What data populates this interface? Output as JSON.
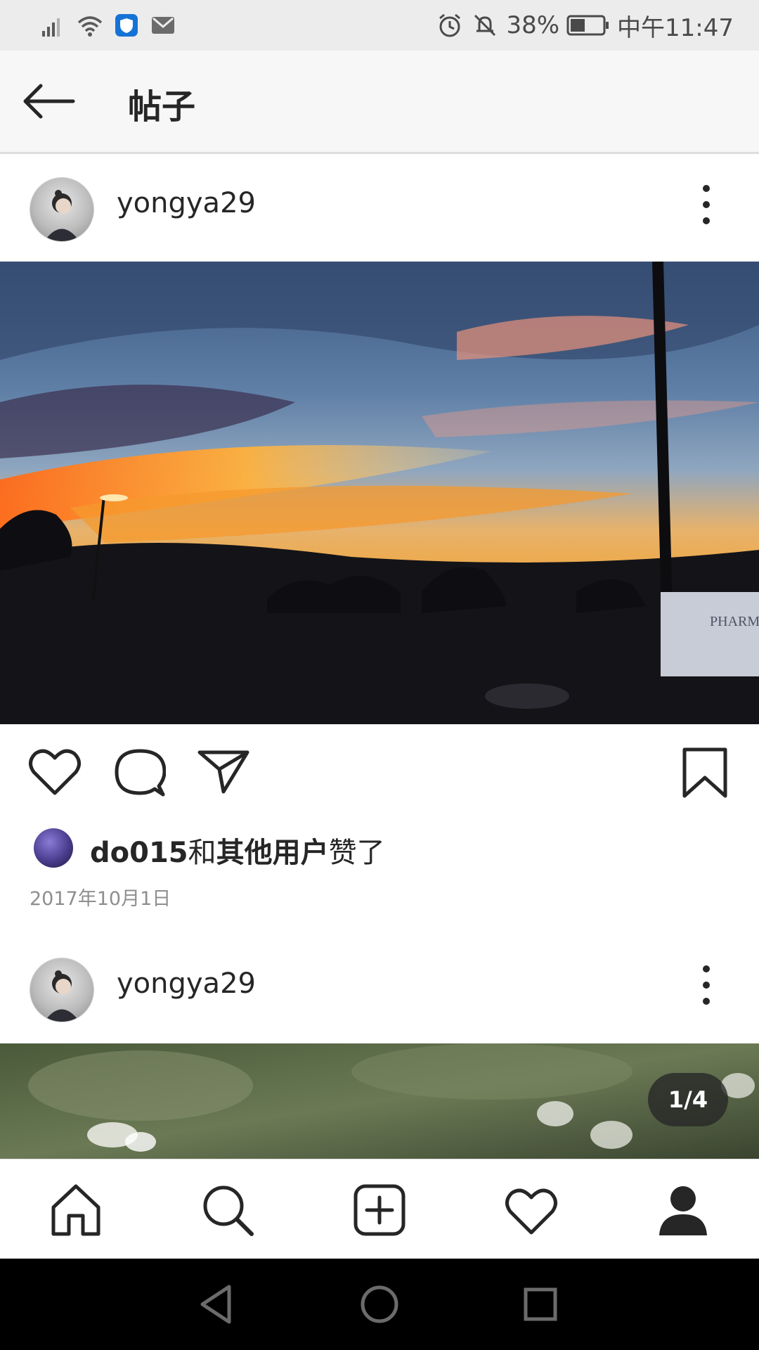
{
  "status_bar": {
    "battery": "38%",
    "time": "中午11:47"
  },
  "header": {
    "title": "帖子"
  },
  "posts": [
    {
      "username": "yongya29",
      "liked_by_user": "do015",
      "liked_by_and": "和",
      "liked_by_others": "其他用户",
      "liked_by_suffix": "赞了",
      "date": "2017年10月1日"
    },
    {
      "username": "yongya29",
      "image_counter": "1/4"
    }
  ],
  "icons": {
    "back": "arrow-left-icon",
    "more": "more-vertical-icon",
    "like": "heart-icon",
    "comment": "comment-icon",
    "share": "send-icon",
    "save": "bookmark-icon",
    "home": "home-icon",
    "search": "search-icon",
    "add": "add-post-icon",
    "activity": "heart-icon",
    "profile": "profile-icon"
  }
}
